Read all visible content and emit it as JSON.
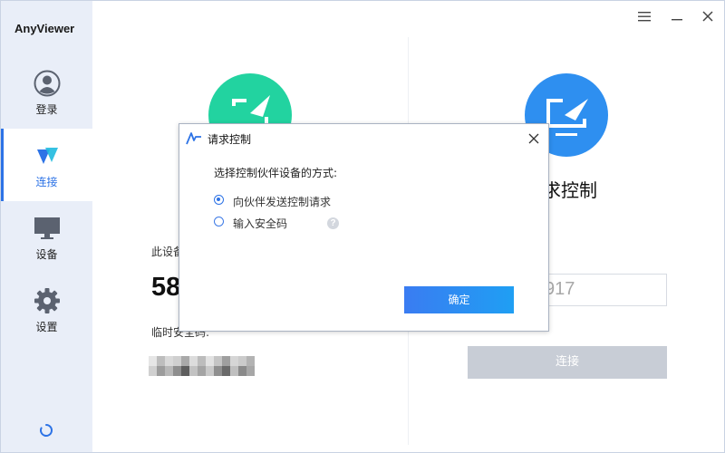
{
  "app": {
    "title": "AnyViewer"
  },
  "sidebar": {
    "items": [
      {
        "label": "登录",
        "icon": "user-icon",
        "active": false
      },
      {
        "label": "连接",
        "icon": "connect-icon",
        "active": true
      },
      {
        "label": "设备",
        "icon": "monitor-icon",
        "active": false
      },
      {
        "label": "设置",
        "icon": "gear-icon",
        "active": false
      }
    ],
    "footer_icon": "loading-spinner-icon"
  },
  "window_controls": [
    "menu-icon",
    "minimize-icon",
    "close-icon"
  ],
  "left_panel": {
    "icon": "remote-screen-icon",
    "device_id_label": "此设备",
    "device_id_visible": "58",
    "temp_code_label": "临时安全码:",
    "temp_code_masked": true
  },
  "right_panel": {
    "icon": "send-request-icon",
    "title_visible": "求控制",
    "partner_id_visible": "917",
    "connect_label": "连接"
  },
  "dialog": {
    "title": "请求控制",
    "prompt": "选择控制伙伴设备的方式:",
    "options": [
      {
        "label": "向伙伴发送控制请求",
        "selected": true
      },
      {
        "label": "输入安全码",
        "selected": false,
        "help": "?"
      }
    ],
    "confirm_label": "确定"
  },
  "colors": {
    "accent": "#2d73e6",
    "sidebar_bg": "#e9eef8",
    "green_circle": "#22d3a0",
    "blue_circle": "#2e8ff0",
    "disabled_button": "#c8cdd6"
  }
}
